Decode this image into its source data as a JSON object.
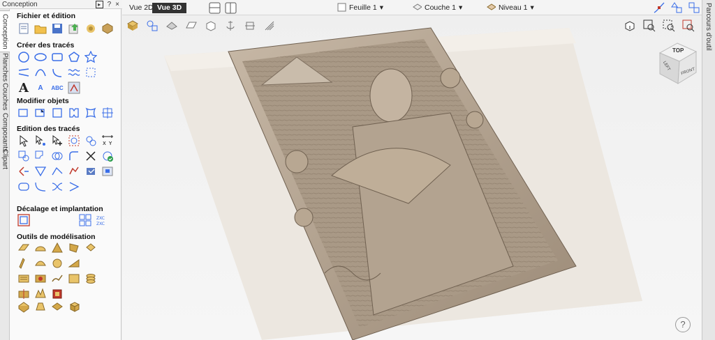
{
  "panel": {
    "title": "Conception",
    "pin": "?",
    "close": "×",
    "sections": {
      "file": "Fichier et édition",
      "create": "Créer des tracés",
      "modify": "Modifier objets",
      "edit": "Edition des tracés",
      "offset": "Décalage et implantation",
      "modeling": "Outils de modélisation"
    }
  },
  "vertical_tabs": [
    "Conception",
    "Planches",
    "Couches",
    "Composants",
    "Clipart"
  ],
  "right_rail": "Parcours d'outil",
  "view_tabs": {
    "v2d": "Vue 2D",
    "v3d": "Vue 3D"
  },
  "dropdowns": {
    "sheet": "Feuille 1",
    "layer": "Couche 1",
    "level": "Niveau 1"
  },
  "viewcube": {
    "top": "TOP",
    "left": "LEFT",
    "front": "FRONT"
  },
  "help": "?",
  "colors": {
    "relief": "#b0a190",
    "relief_dark": "#7d6e5e",
    "accent": "#3a6ee8"
  }
}
